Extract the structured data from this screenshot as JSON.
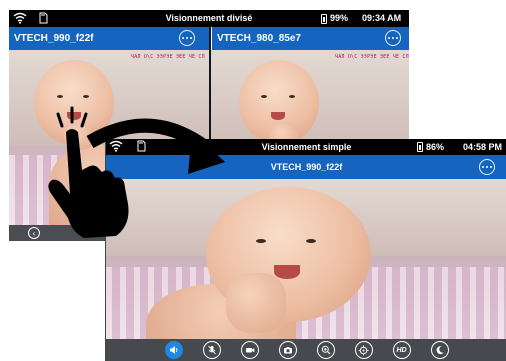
{
  "split_view": {
    "status": {
      "title": "Visionnement divisé",
      "battery": "99%",
      "time": "09:34 AM",
      "icons": [
        "wifi-icon",
        "sd-card-icon",
        "battery-icon"
      ]
    },
    "cameras": [
      {
        "name": "VTECH_990_f22f",
        "code": "ЧАЛ О\\С ЭЭРЭЕ ЭЕЕ ЧЕ СЛ"
      },
      {
        "name": "VTECH_980_85e7",
        "code": "ЧАЛ О\\С ЭЭРЭЕ ЭЕЕ ЧЕ СЛ"
      }
    ],
    "bottom": {
      "back_icon": "back-arrow-icon"
    }
  },
  "single_view": {
    "status": {
      "title": "Visionnement simple",
      "battery": "86%",
      "time": "04:58 PM",
      "icons": [
        "wifi-icon",
        "sd-card-icon",
        "battery-icon"
      ]
    },
    "camera_name": "VTECH_990_f22f",
    "toolbar": [
      {
        "icon": "speaker-icon",
        "active": true
      },
      {
        "icon": "mute-mic-icon",
        "active": false
      },
      {
        "icon": "video-record-icon",
        "active": false
      },
      {
        "icon": "camera-snapshot-icon",
        "active": false
      },
      {
        "icon": "zoom-in-icon",
        "active": false
      },
      {
        "icon": "crosshair-icon",
        "active": false
      },
      {
        "icon": "hd-icon",
        "label": "HD",
        "active": false
      },
      {
        "icon": "night-mode-icon",
        "active": false
      }
    ]
  },
  "overlay": {
    "gesture": "double-tap-hand-icon",
    "arrow": "curved-arrow-icon"
  },
  "colors": {
    "header_blue": "#1565c0",
    "active_blue": "#1e88e5",
    "toolbar_gray": "#46494e",
    "status_black": "#000000"
  }
}
